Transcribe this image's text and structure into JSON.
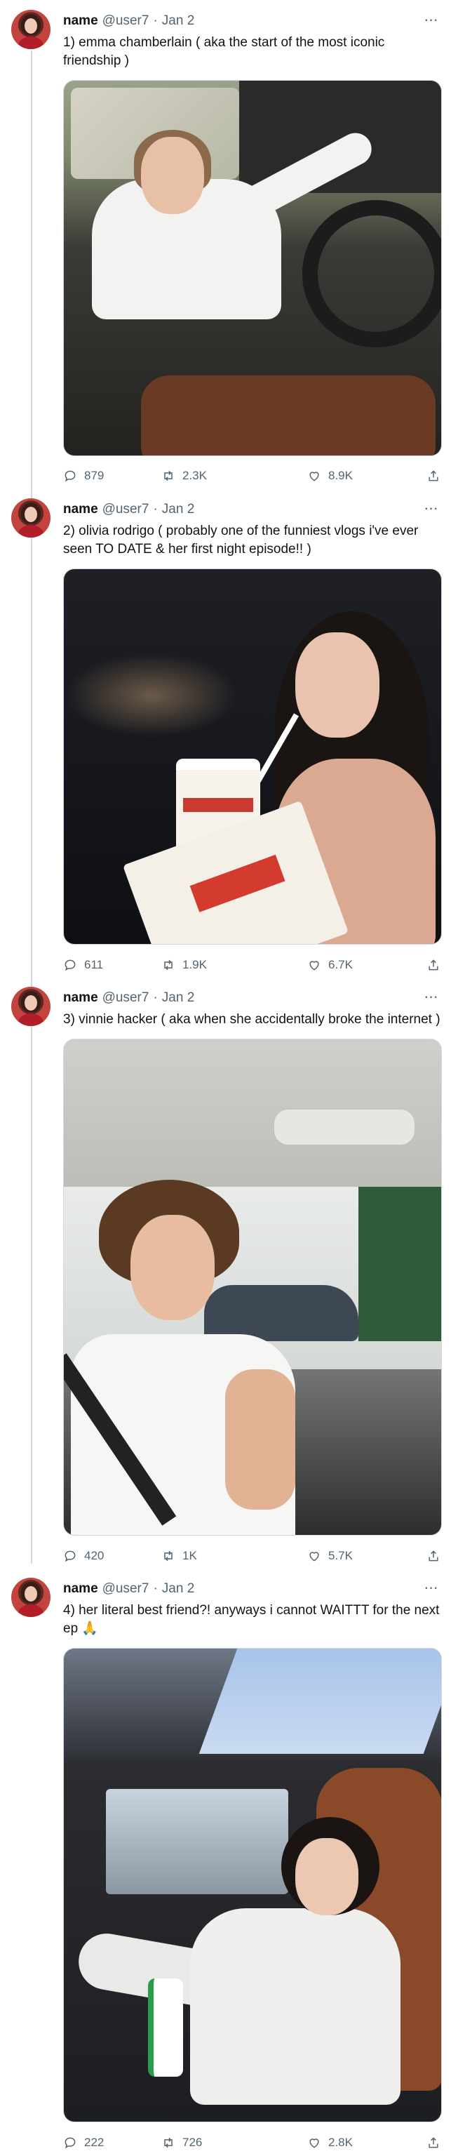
{
  "tweets": [
    {
      "name": "name",
      "handle": "@user7",
      "separator": "·",
      "date": "Jan 2",
      "text": "1) emma chamberlain ( aka the start of the most iconic friendship )",
      "replies": "879",
      "retweets": "2.3K",
      "likes": "8.9K",
      "more": "⋯"
    },
    {
      "name": "name",
      "handle": "@user7",
      "separator": "·",
      "date": "Jan 2",
      "text": "2) olivia rodrigo ( probably one of the funniest vlogs i've ever seen TO DATE & her first night episode!! )",
      "replies": "611",
      "retweets": "1.9K",
      "likes": "6.7K",
      "more": "⋯"
    },
    {
      "name": "name",
      "handle": "@user7",
      "separator": "·",
      "date": "Jan 2",
      "text": "3) vinnie hacker ( aka when she accidentally broke the internet )",
      "replies": "420",
      "retweets": "1K",
      "likes": "5.7K",
      "more": "⋯"
    },
    {
      "name": "name",
      "handle": "@user7",
      "separator": "·",
      "date": "Jan 2",
      "text": "4) her literal best friend?! anyways i cannot WAITTT for the next ep 🙏",
      "replies": "222",
      "retweets": "726",
      "likes": "2.8K",
      "more": "⋯"
    }
  ],
  "icons": {
    "reply": "reply-icon",
    "retweet": "retweet-icon",
    "like": "heart-icon",
    "share": "share-icon"
  },
  "colors": {
    "text": "#0f1419",
    "secondary": "#536471",
    "border": "#cfd9de"
  }
}
